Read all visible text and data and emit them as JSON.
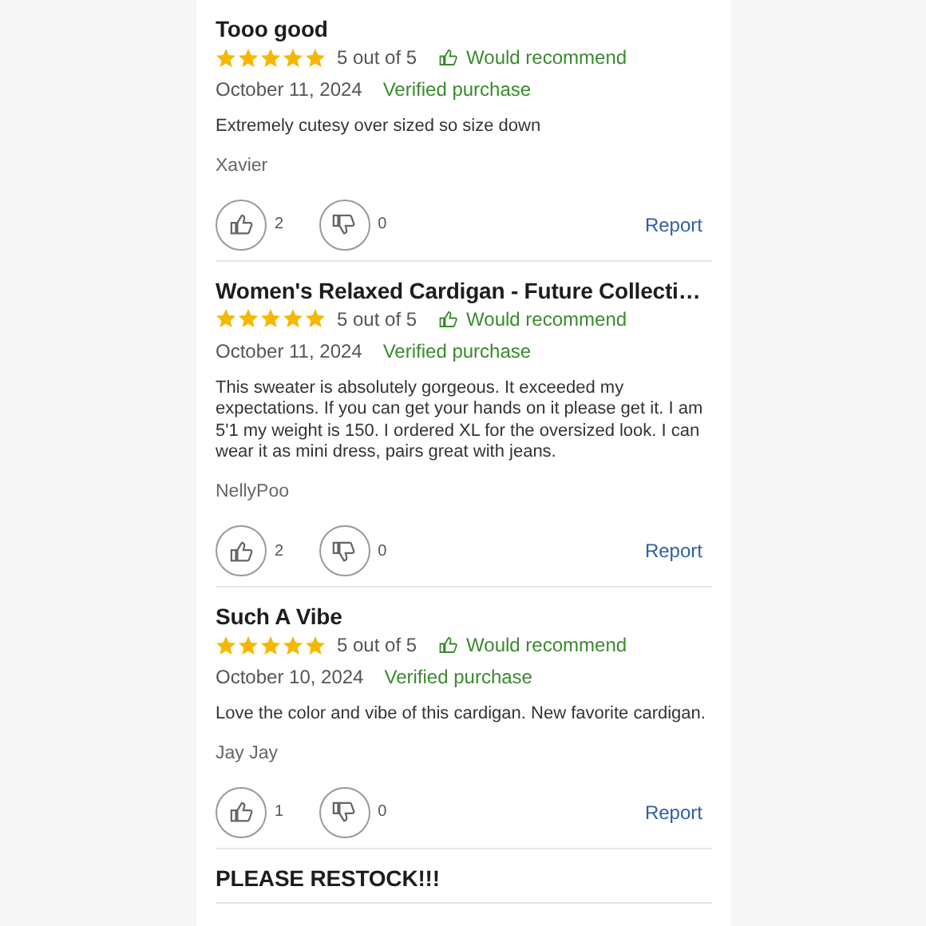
{
  "reviews": [
    {
      "title": "Tooo good",
      "stars": 5,
      "rating": "5 out of 5",
      "recommend": true,
      "recommend_label": "Would recommend",
      "date": "October 11, 2024",
      "verified": "Verified purchase",
      "body": "Extremely cutesy over sized so size down",
      "author": "Xavier",
      "helpful": "2",
      "unhelpful": "0",
      "report": "Report"
    },
    {
      "title": "Women's Relaxed Cardigan - Future Collecti…",
      "stars": 5,
      "rating": "5 out of 5",
      "recommend": true,
      "recommend_label": "Would recommend",
      "date": "October 11, 2024",
      "verified": "Verified purchase",
      "body": "This sweater is absolutely gorgeous. It exceeded my expectations. If you can get your hands on it please get it. I am 5'1 my weight is 150. I ordered XL for the oversized look. I can wear it as mini dress, pairs great with jeans.",
      "author": "NellyPoo",
      "helpful": "2",
      "unhelpful": "0",
      "report": "Report"
    },
    {
      "title": "Such A Vibe",
      "stars": 5,
      "rating": "5 out of 5",
      "recommend": true,
      "recommend_label": "Would recommend",
      "date": "October 10, 2024",
      "verified": "Verified purchase",
      "body": "Love the color and vibe of this cardigan. New favorite cardigan.",
      "author": "Jay Jay",
      "helpful": "1",
      "unhelpful": "0",
      "report": "Report"
    },
    {
      "title": "PLEASE RESTOCK!!!"
    }
  ]
}
